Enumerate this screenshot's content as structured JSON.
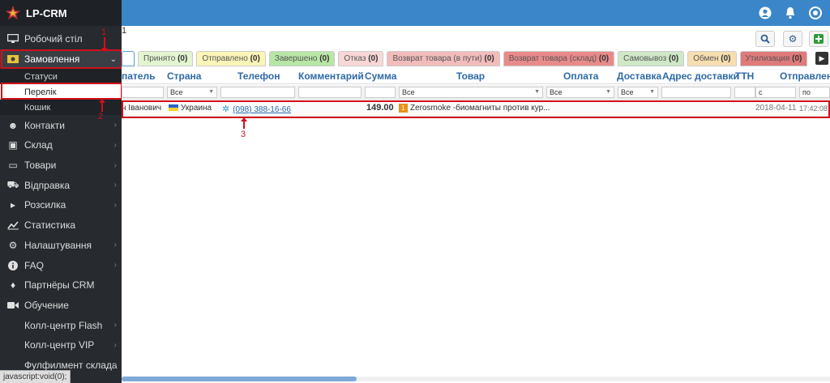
{
  "app": {
    "title": "LP-CRM",
    "brand_icon": "star-logo-icon"
  },
  "sidebar": {
    "items": [
      {
        "label": "Робочий стіл",
        "icon": "desktop-icon"
      },
      {
        "label": "Замовлення",
        "icon": "money-icon"
      },
      {
        "label": "Контакти",
        "icon": "users-icon"
      },
      {
        "label": "Склад",
        "icon": "box-icon"
      },
      {
        "label": "Товари",
        "icon": "tray-icon"
      },
      {
        "label": "Відправка",
        "icon": "truck-icon"
      },
      {
        "label": "Розсилка",
        "icon": "bullhorn-icon"
      },
      {
        "label": "Статистика",
        "icon": "chart-icon"
      },
      {
        "label": "Налаштування",
        "icon": "gear-icon"
      },
      {
        "label": "FAQ",
        "icon": "info-icon"
      },
      {
        "label": "Партнёры CRM",
        "icon": "handshake-icon"
      },
      {
        "label": "Обучение",
        "icon": "video-icon"
      },
      {
        "label": "Колл-центр Flash"
      },
      {
        "label": "Колл-центр VIP"
      },
      {
        "label": "Фулфилмент склада"
      }
    ],
    "orders_sub": [
      "Статуси",
      "Перелік",
      "Кошик"
    ]
  },
  "statusbar": {
    "text": "javascript:void(0);"
  },
  "header": {
    "breadcrumb": "1"
  },
  "tabs": [
    {
      "label": "Принято",
      "count": "(0)",
      "color": "#e3f5d0"
    },
    {
      "label": "Отправлено",
      "count": "(0)",
      "color": "#fbf5b8"
    },
    {
      "label": "Завершено",
      "count": "(0)",
      "color": "#b8e6a6"
    },
    {
      "label": "Отказ",
      "count": "(0)",
      "color": "#f8d7d6"
    },
    {
      "label": "Возврат товара (в пути)",
      "count": "(0)",
      "color": "#f2bcbc"
    },
    {
      "label": "Возврат товара (склад)",
      "count": "(0)",
      "color": "#e98a8a"
    },
    {
      "label": "Самовывоз",
      "count": "(0)",
      "color": "#cfe8c7"
    },
    {
      "label": "Обмен",
      "count": "(0)",
      "color": "#f6deaf"
    },
    {
      "label": "Утилизация",
      "count": "(0)",
      "color": "#e07a7a"
    }
  ],
  "table": {
    "columns": [
      "патель",
      "Страна",
      "Телефон",
      "Комментарий",
      "Сумма",
      "Товар",
      "Оплата",
      "Доставка",
      "Адрес доставки",
      "ТТН",
      "Отправлен"
    ],
    "filters": {
      "country": "Все",
      "product": "Все",
      "payment": "Все",
      "delivery": "Все",
      "ttn": "c",
      "sent": "по"
    },
    "row": {
      "customer": "н Іванович",
      "country": "Украина",
      "phone": "(098) 388-16-66",
      "sum": "149.00",
      "product_badge": "1",
      "product": "Zerosmoke -биомагниты против кур...",
      "date": "2018-04-11",
      "time": "17:42:08"
    }
  },
  "annotations": [
    "1",
    "2",
    "3"
  ]
}
